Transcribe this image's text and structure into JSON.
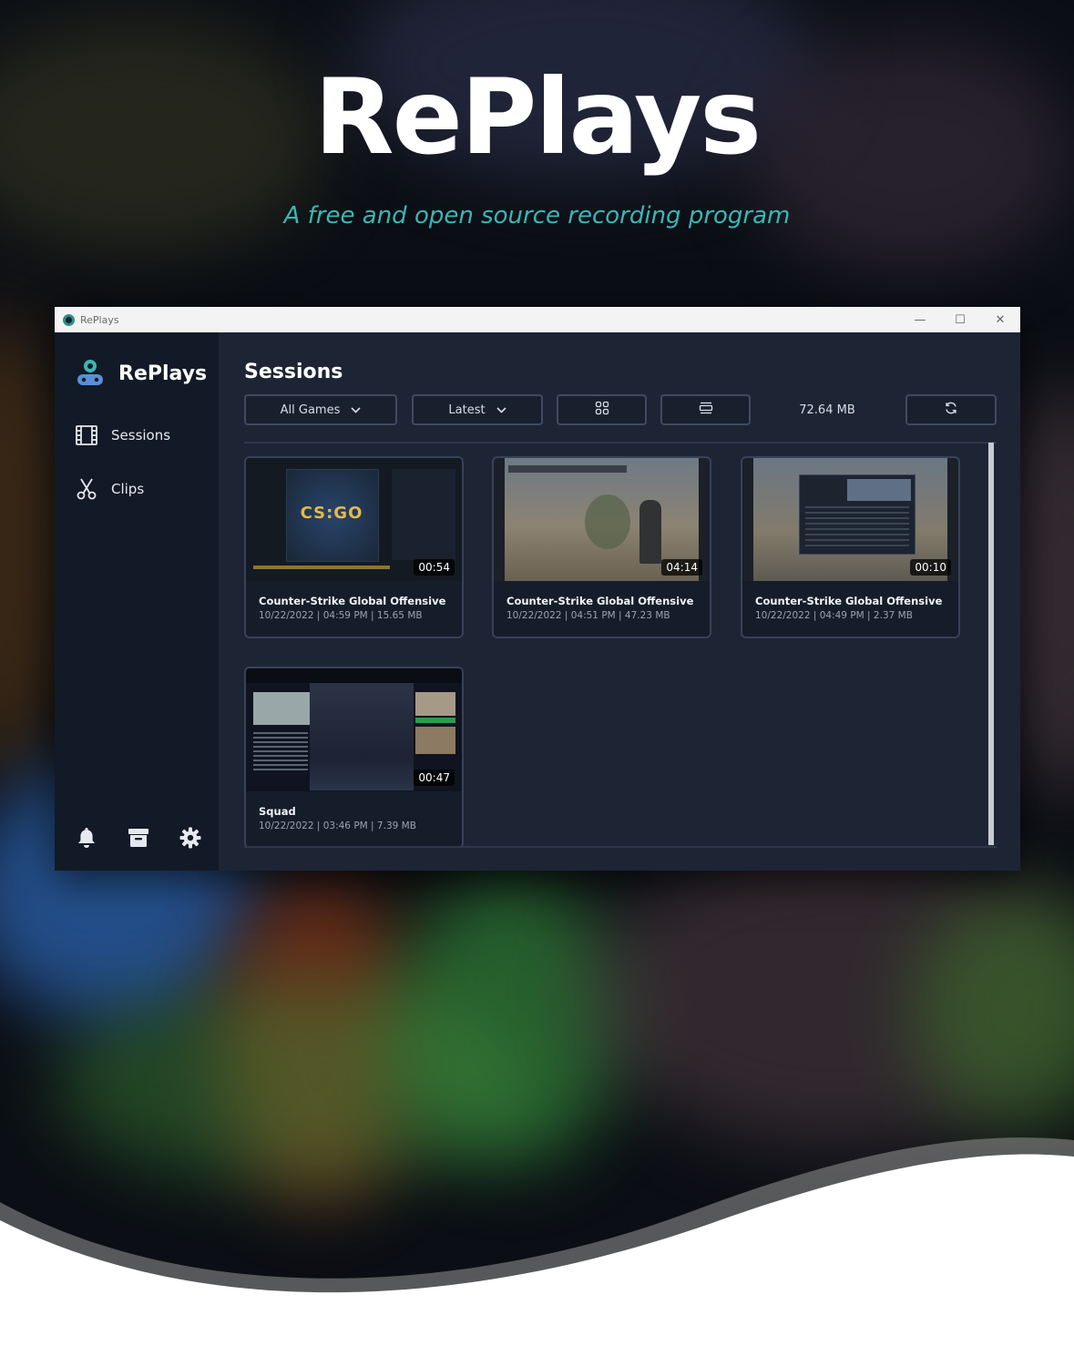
{
  "hero": {
    "title": "RePlays",
    "subtitle": "A free and open source recording program"
  },
  "window": {
    "title": "RePlays",
    "controls": {
      "minimize": "—",
      "maximize": "☐",
      "close": "✕"
    }
  },
  "sidebar": {
    "brand": "RePlays",
    "items": [
      {
        "label": "Sessions",
        "icon": "film-icon"
      },
      {
        "label": "Clips",
        "icon": "scissors-icon"
      }
    ],
    "bottom_icons": [
      "bell-icon",
      "archive-icon",
      "gear-icon"
    ]
  },
  "main": {
    "title": "Sessions",
    "toolbar": {
      "game_filter": "All Games",
      "sort": "Latest",
      "grid_view_icon": "grid-icon",
      "list_view_icon": "list-icon",
      "total_size": "72.64 MB",
      "refresh_icon": "refresh-icon"
    },
    "sessions": [
      {
        "game": "Counter-Strike Global Offensive",
        "meta": "10/22/2022 | 04:59 PM | 15.65 MB",
        "duration": "00:54",
        "thumb_text": "CS:GO"
      },
      {
        "game": "Counter-Strike Global Offensive",
        "meta": "10/22/2022 | 04:51 PM | 47.23 MB",
        "duration": "04:14"
      },
      {
        "game": "Counter-Strike Global Offensive",
        "meta": "10/22/2022 | 04:49 PM | 2.37 MB",
        "duration": "00:10"
      },
      {
        "game": "Squad",
        "meta": "10/22/2022 | 03:46 PM | 7.39 MB",
        "duration": "00:47"
      }
    ]
  },
  "colors": {
    "accent": "#3bb7b3",
    "sidebar_bg": "#121a27",
    "main_bg": "#1d2535",
    "card_border": "#37425a"
  }
}
